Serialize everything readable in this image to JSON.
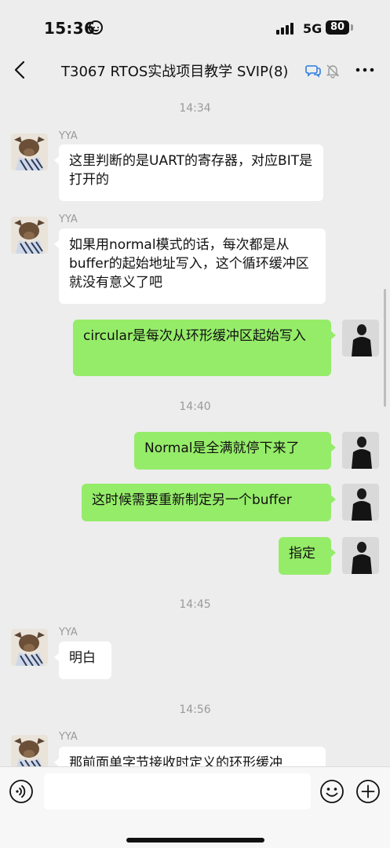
{
  "status_bar": {
    "time": "15:36",
    "network": "5G",
    "battery": "80"
  },
  "header": {
    "title": "T3067 RTOS实战项目教学 SVIP(8)"
  },
  "messages": [
    {
      "kind": "timestamp",
      "text": "14:34"
    },
    {
      "kind": "incoming",
      "sender": "YYA",
      "text": "这里判断的是UART的寄存器，对应BIT是打开的"
    },
    {
      "kind": "incoming",
      "sender": "YYA",
      "text": "如果用normal模式的话，每次都是从buffer的起始地址写入，这个循环缓冲区就没有意义了吧"
    },
    {
      "kind": "outgoing",
      "text": "circular是每次从环形缓冲区起始写入"
    },
    {
      "kind": "timestamp",
      "text": "14:40"
    },
    {
      "kind": "outgoing",
      "text": "Normal是全满就停下来了"
    },
    {
      "kind": "outgoing",
      "text": "这时候需要重新制定另一个buffer"
    },
    {
      "kind": "outgoing",
      "text": "指定"
    },
    {
      "kind": "timestamp",
      "text": "14:45"
    },
    {
      "kind": "incoming",
      "sender": "YYA",
      "text": "明白"
    },
    {
      "kind": "timestamp",
      "text": "14:56"
    },
    {
      "kind": "incoming",
      "sender": "YYA",
      "text": "那前面单字节接收时定义的环形缓冲"
    }
  ],
  "input_bar": {
    "text": "",
    "icons": [
      "voice-icon",
      "emoji-icon",
      "plus-icon"
    ]
  },
  "colors": {
    "background": "#ededed",
    "outgoing_bubble": "#95ec69",
    "incoming_bubble": "#ffffff",
    "timestamp": "#9a9a9a"
  }
}
